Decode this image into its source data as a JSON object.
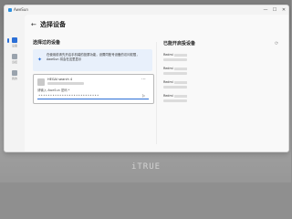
{
  "app": {
    "name": "AweSun"
  },
  "window_controls": {
    "minimize": "—",
    "maximize": "☐",
    "close": "✕"
  },
  "sidebar": {
    "items": [
      {
        "icon": "device-icon",
        "label": "设备",
        "active": true
      },
      {
        "icon": "remote-icon",
        "label": "远控",
        "active": false
      },
      {
        "icon": "user-icon",
        "label": "我的",
        "active": false
      }
    ]
  },
  "header": {
    "back": "←",
    "title": "选择设备"
  },
  "selected_section": {
    "title": "选择过的设备",
    "help_text": "在使用前请先开启手机端的投屏功能，设置同账号设备的访问权限，AweSun 将会在这里显示",
    "device": {
      "name": "HEGAI search 4",
      "password_label": "请输入 AweSun 密码 *",
      "password_value": "••••••••••••••••••••••••••"
    }
  },
  "nearby_section": {
    "title": "已能开启投设备",
    "devices": [
      {
        "name": "Redmi"
      },
      {
        "name": "Redmi"
      },
      {
        "name": "Redmi"
      },
      {
        "name": "Redmi"
      }
    ]
  },
  "watermark": "iTRUE"
}
